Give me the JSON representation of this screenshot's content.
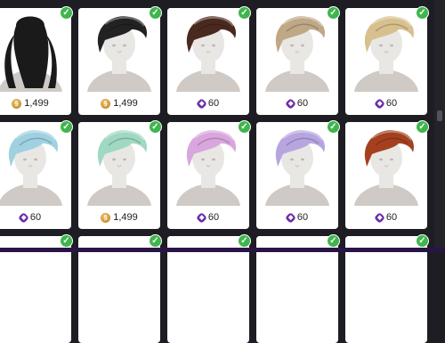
{
  "items": [
    {
      "name": "long-wavy-hair",
      "hair_color": "#1a1a1a",
      "style": "long",
      "currency": "simoleon",
      "price": "1,499",
      "owned": true
    },
    {
      "name": "slick-hair-black",
      "hair_color": "#222222",
      "style": "short",
      "currency": "simoleon",
      "price": "1,499",
      "owned": true
    },
    {
      "name": "slick-hair-brown",
      "hair_color": "#4a2a1e",
      "style": "short",
      "currency": "moola",
      "price": "60",
      "owned": true
    },
    {
      "name": "slick-hair-ash",
      "hair_color": "#bfa886",
      "style": "short",
      "currency": "moola",
      "price": "60",
      "owned": true
    },
    {
      "name": "slick-hair-blonde",
      "hair_color": "#d8c08e",
      "style": "short",
      "currency": "moola",
      "price": "60",
      "owned": true
    },
    {
      "name": "slick-hair-ice-blue",
      "hair_color": "#9fd1e0",
      "style": "short",
      "currency": "moola",
      "price": "60",
      "owned": true
    },
    {
      "name": "slick-hair-mint",
      "hair_color": "#9fd9c1",
      "style": "short",
      "currency": "simoleon",
      "price": "1,499",
      "owned": true
    },
    {
      "name": "slick-hair-pink",
      "hair_color": "#d9a6de",
      "style": "short",
      "currency": "moola",
      "price": "60",
      "owned": true
    },
    {
      "name": "slick-hair-lavender",
      "hair_color": "#b7a5e0",
      "style": "short",
      "currency": "moola",
      "price": "60",
      "owned": true
    },
    {
      "name": "slick-hair-auburn",
      "hair_color": "#a5401f",
      "style": "short",
      "currency": "moola",
      "price": "60",
      "owned": true
    },
    {
      "name": "partial-item-1",
      "hair_color": "#ffffff",
      "style": "none",
      "currency": "",
      "price": "",
      "owned": true
    },
    {
      "name": "partial-item-2",
      "hair_color": "#ffffff",
      "style": "none",
      "currency": "",
      "price": "",
      "owned": true
    },
    {
      "name": "partial-item-3",
      "hair_color": "#ffffff",
      "style": "none",
      "currency": "",
      "price": "",
      "owned": true
    },
    {
      "name": "partial-item-4",
      "hair_color": "#ffffff",
      "style": "none",
      "currency": "",
      "price": "",
      "owned": true
    },
    {
      "name": "partial-item-5",
      "hair_color": "#1a1a1a",
      "style": "none",
      "currency": "",
      "price": "",
      "owned": true
    }
  ],
  "icons": {
    "simoleon": "simoleon-coin-icon",
    "moola": "moola-gem-icon",
    "owned": "checkmark-icon"
  },
  "colors": {
    "background": "#1d1d23",
    "card": "#ffffff",
    "owned_badge": "#3fb64d",
    "simoleon": "#c48a2a",
    "moola": "#6b2ea6"
  }
}
